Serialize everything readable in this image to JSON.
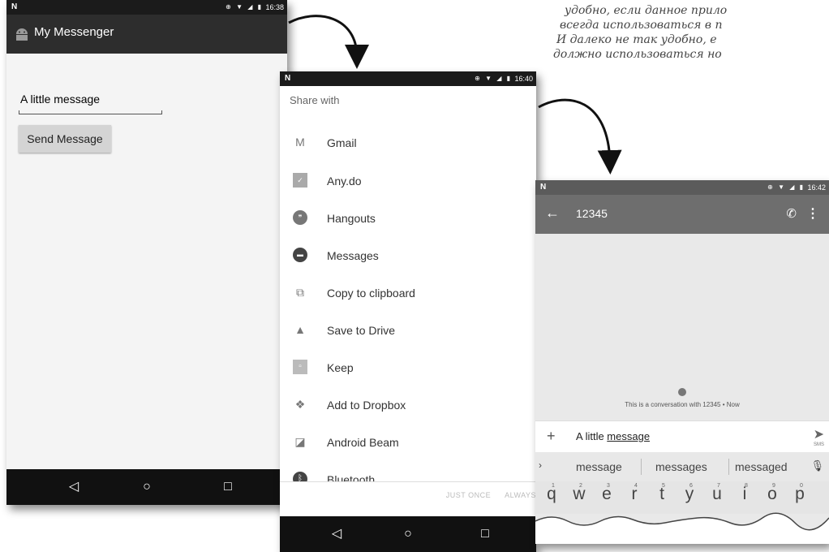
{
  "phone1": {
    "status": {
      "carrier_icon": "N",
      "time": "16:38"
    },
    "app_title": "My Messenger",
    "message_input_value": "A little message",
    "send_button_label": "Send Message",
    "nav": {
      "back": "◁",
      "home": "○",
      "recents": "□"
    }
  },
  "phone2": {
    "status": {
      "carrier_icon": "N",
      "time": "16:40"
    },
    "share_header": "Share with",
    "share_items": [
      {
        "label": "Gmail",
        "icon": "gmail-icon"
      },
      {
        "label": "Any.do",
        "icon": "anydo-icon"
      },
      {
        "label": "Hangouts",
        "icon": "hangouts-icon"
      },
      {
        "label": "Messages",
        "icon": "messages-icon"
      },
      {
        "label": "Copy to clipboard",
        "icon": "copy-icon"
      },
      {
        "label": "Save to Drive",
        "icon": "drive-icon"
      },
      {
        "label": "Keep",
        "icon": "keep-icon"
      },
      {
        "label": "Add to Dropbox",
        "icon": "dropbox-icon"
      },
      {
        "label": "Android Beam",
        "icon": "android-beam-icon"
      },
      {
        "label": "Bluetooth",
        "icon": "bluetooth-icon"
      }
    ],
    "just_once": "JUST ONCE",
    "always": "ALWAYS",
    "nav": {
      "back": "◁",
      "home": "○",
      "recents": "□"
    }
  },
  "phone3": {
    "status": {
      "carrier_icon": "N",
      "time": "16:42"
    },
    "recipient": "12345",
    "conversation_note": "This is a conversation with 12345 • Now",
    "composer_text_plain": "A little ",
    "composer_text_underlined": "message",
    "sms_label": "SMS",
    "suggestions": [
      "message",
      "messages",
      "messaged"
    ],
    "keys": [
      {
        "letter": "q",
        "num": "1"
      },
      {
        "letter": "w",
        "num": "2"
      },
      {
        "letter": "e",
        "num": "3"
      },
      {
        "letter": "r",
        "num": "4"
      },
      {
        "letter": "t",
        "num": "5"
      },
      {
        "letter": "y",
        "num": "6"
      },
      {
        "letter": "u",
        "num": "7"
      },
      {
        "letter": "i",
        "num": "8"
      },
      {
        "letter": "o",
        "num": "9"
      },
      {
        "letter": "p",
        "num": "0"
      }
    ]
  },
  "note_lines": [
    "удобно, если данное прило",
    "всегда использоваться в п",
    "И далеко не так удобно, е",
    "должно использоваться но"
  ],
  "colors": {
    "status_bar": "#1b1b1b",
    "app_bar": "#2d2d2d",
    "messages_toolbar": "#6e6e6e"
  }
}
